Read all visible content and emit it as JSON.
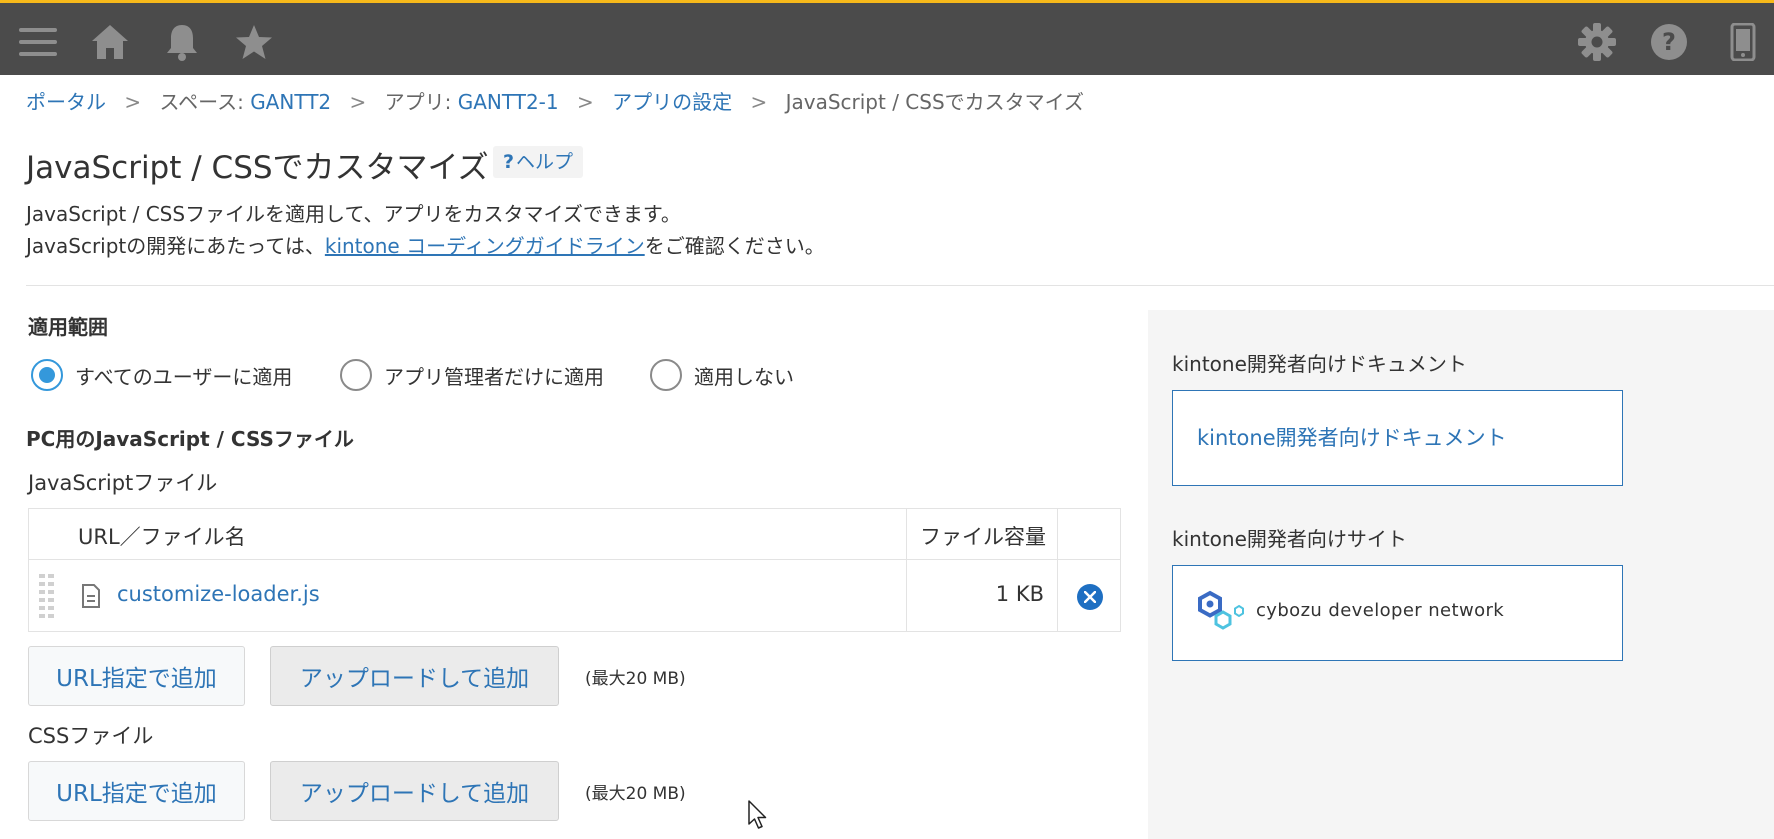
{
  "topbar": {
    "accent_color": "#f7b91a",
    "background_color": "#4b4b4b",
    "icons": [
      "menu-icon",
      "home-icon",
      "bell-icon",
      "star-icon",
      "gear-icon",
      "help-icon",
      "mobile-icon"
    ]
  },
  "breadcrumb": {
    "items": [
      "ポータル",
      "スペース: GANTT2",
      "アプリ: GANTT2-1",
      "アプリの設定",
      "JavaScript / CSSでカスタマイズ"
    ],
    "space_prefix": "スペース: ",
    "space_name": "GANTT2",
    "app_prefix": "アプリ: ",
    "app_name": "GANTT2-1",
    "separator": ">"
  },
  "page": {
    "title": "JavaScript / CSSでカスタマイズ",
    "help_label": "ヘルプ",
    "help_mark": "?",
    "desc_line1": "JavaScript / CSSファイルを適用して、アプリをカスタマイズできます。",
    "desc_line2_prefix": "JavaScriptの開発にあたっては、",
    "desc_line2_link": "kintone コーディングガイドライン",
    "desc_line2_suffix": "をご確認ください。"
  },
  "scope": {
    "label": "適用範囲",
    "options": [
      {
        "label": "すべてのユーザーに適用",
        "selected": true
      },
      {
        "label": "アプリ管理者だけに適用",
        "selected": false
      },
      {
        "label": "適用しない",
        "selected": false
      }
    ]
  },
  "pc_files": {
    "section_title": "PC用のJavaScript / CSSファイル",
    "js_label": "JavaScriptファイル",
    "table": {
      "columns": [
        "URL／ファイル名",
        "ファイル容量"
      ],
      "rows": [
        {
          "name": "customize-loader.js",
          "size": "1 KB"
        }
      ]
    },
    "css_label": "CSSファイル",
    "add_url_label": "URL指定で追加",
    "upload_label": "アップロードして追加",
    "max_size": "(最大20 MB)"
  },
  "sidebar": {
    "docs_title": "kintone開発者向けドキュメント",
    "docs_link": "kintone開発者向けドキュメント",
    "site_title": "kintone開発者向けサイト",
    "site_link": "cybozu developer network"
  }
}
